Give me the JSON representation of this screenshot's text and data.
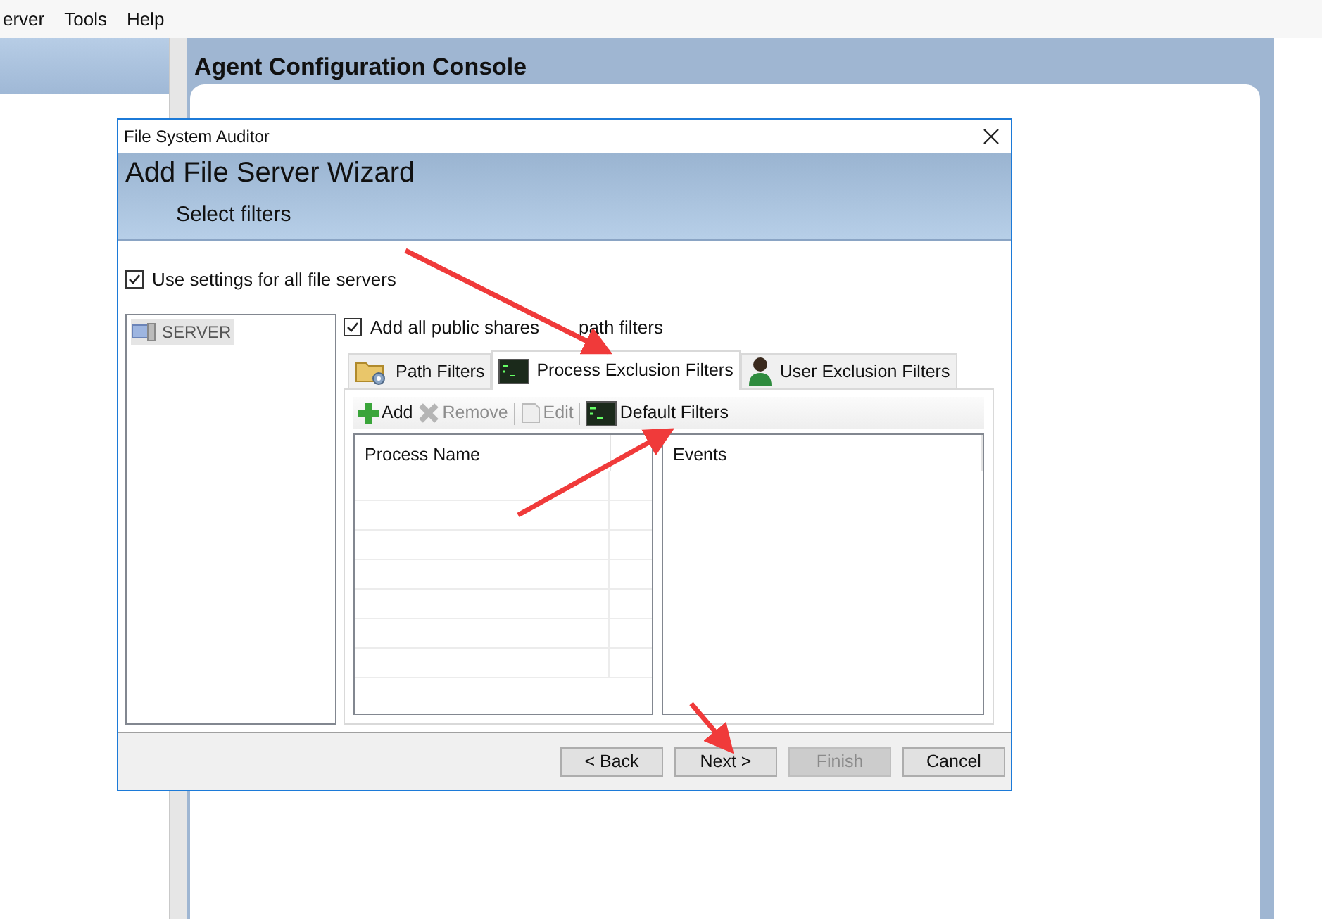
{
  "menu": [
    {
      "label": "erver"
    },
    {
      "label": "Tools"
    },
    {
      "label": "Help"
    }
  ],
  "console": {
    "title": "Agent Configuration Console"
  },
  "dialog": {
    "title": "File System Auditor",
    "heading": "Add File Server Wizard",
    "subheading": "Select filters",
    "use_all": {
      "label": "Use settings for all file servers",
      "checked": true
    },
    "servers": [
      {
        "label": "SERVER",
        "selected": true
      }
    ],
    "add_shares": {
      "label": "Add all public shares",
      "label_end": "path filters",
      "checked": true
    },
    "tabs": [
      {
        "label": "Path Filters",
        "kind": "folder",
        "selected": false
      },
      {
        "label": "Process Exclusion Filters",
        "kind": "terminal",
        "selected": true
      },
      {
        "label": "User Exclusion Filters",
        "kind": "user",
        "selected": false
      }
    ],
    "toolbar": [
      {
        "label": "Add",
        "kind": "add",
        "disabled": false
      },
      {
        "label": "Remove",
        "kind": "remove",
        "disabled": true
      },
      {
        "label": "Edit",
        "kind": "edit",
        "disabled": true
      },
      {
        "label": "Default Filters",
        "kind": "terminal",
        "disabled": false
      }
    ],
    "process_table": {
      "columns": [
        "Process Name"
      ]
    },
    "events_table": {
      "columns": [
        "Events"
      ]
    },
    "buttons": [
      {
        "label": "< Back",
        "disabled": false
      },
      {
        "label": "Next >",
        "disabled": false
      },
      {
        "label": "Finish",
        "disabled": true
      },
      {
        "label": "Cancel",
        "disabled": false
      }
    ]
  },
  "annotations": [
    {
      "kind": "arrow"
    },
    {
      "kind": "arrow"
    },
    {
      "kind": "arrow"
    }
  ]
}
